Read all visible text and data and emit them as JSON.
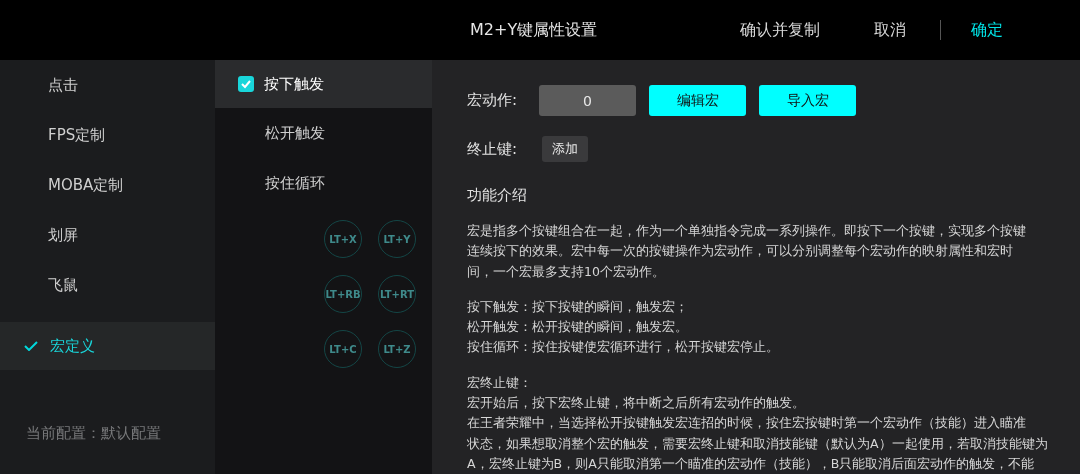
{
  "title": "M2+Y键属性设置",
  "actions": [
    {
      "label": "确认并复制",
      "kind": "text"
    },
    {
      "label": "取消",
      "kind": "text"
    },
    {
      "label": "确定",
      "kind": "primary"
    }
  ],
  "categories": [
    {
      "label": "点击",
      "selected": false
    },
    {
      "label": "FPS定制",
      "selected": false
    },
    {
      "label": "MOBA定制",
      "selected": false
    },
    {
      "label": "划屏",
      "selected": false
    },
    {
      "label": "飞鼠",
      "selected": false
    },
    {
      "label": "宏定义",
      "selected": true
    }
  ],
  "current_config": "当前配置：默认配置",
  "triggers": [
    {
      "label": "按下触发",
      "selected": true
    },
    {
      "label": "松开触发",
      "selected": false
    },
    {
      "label": "按住循环",
      "selected": false
    }
  ],
  "background_buttons": [
    "LT+X",
    "LT+Y",
    "LT+RB",
    "LT+RT",
    "LT+C",
    "LT+Z"
  ],
  "macro": {
    "label": "宏动作:",
    "value": "0",
    "buttons": [
      "编辑宏",
      "导入宏"
    ]
  },
  "stop_key": {
    "label": "终止键:",
    "button": "添加"
  },
  "intro": {
    "title": "功能介绍",
    "paragraphs": [
      [
        "宏是指多个按键组合在一起，作为一个单独指令完成一系列操作。即按下一个按键，实现多个按键",
        "连续按下的效果。宏中每一次的按键操作为宏动作，可以分别调整每个宏动作的映射属性和宏时",
        "间，一个宏最多支持10个宏动作。"
      ],
      [
        "按下触发：按下按键的瞬间，触发宏；",
        "松开触发：松开按键的瞬间，触发宏。",
        "按住循环：按住按键使宏循环进行，松开按键宏停止。"
      ],
      [
        "宏终止键：",
        "宏开始后，按下宏终止键，将中断之后所有宏动作的触发。",
        "在王者荣耀中，当选择松开按键触发宏连招的时候，按住宏按键时第一个宏动作（技能）进入瞄准",
        "状态，如果想取消整个宏的触发，需要宏终止键和取消技能键（默认为A）一起使用，若取消技能键为",
        "A，宏终止键为B，则A只能取消第一个瞄准的宏动作（技能），B只能取消后面宏动作的触发，不能"
      ]
    ]
  }
}
